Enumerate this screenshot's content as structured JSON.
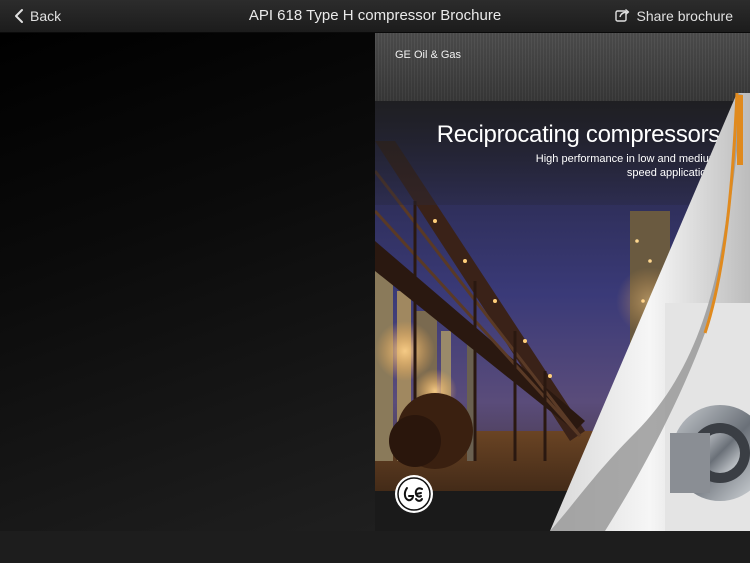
{
  "header": {
    "back_label": "Back",
    "title": "API 618 Type H compressor Brochure",
    "share_label": "Share brochure"
  },
  "icons": {
    "back": "chevron-left-icon",
    "share": "share-icon",
    "logo": "ge-logo-icon"
  },
  "cover": {
    "brand": "GE Oil & Gas",
    "headline": "Reciprocating compressors",
    "subline": "High performance in low and medium speed applications"
  },
  "colors": {
    "topbar": "#262626",
    "background": "#000000",
    "accent_orange": "#e08a1e"
  }
}
